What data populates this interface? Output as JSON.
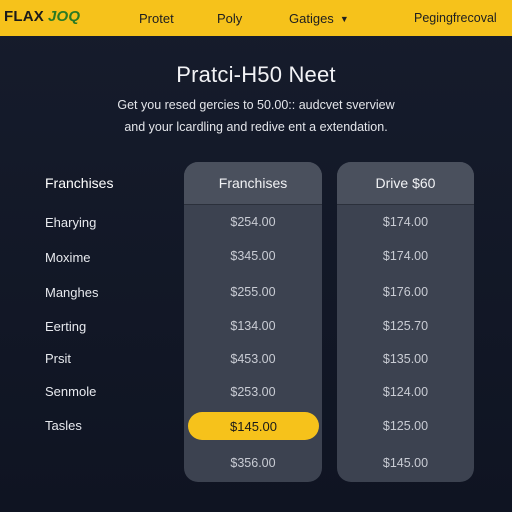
{
  "nav": {
    "logo_part1": "FLAX",
    "logo_part2": "JOQ",
    "product": "Protet",
    "policy": "Poly",
    "categories": "Gatiges",
    "right": "Pegingfrecoval"
  },
  "hero": {
    "title": "Pratci-H50 Neet",
    "subtitle_line1": "Get you resed gercies to 50.00:: audcvet sverview",
    "subtitle_line2": "and your lcardling and redive ent a extendation."
  },
  "table": {
    "row_header": "Franchises",
    "columns": [
      "Franchises",
      "Drive $60"
    ],
    "rows": [
      {
        "label": "Eharying",
        "c1": "$254.00",
        "c2": "$174.00"
      },
      {
        "label": "Moxime",
        "c1": "$345.00",
        "c2": "$174.00"
      },
      {
        "label": "Manghes",
        "c1": "$255.00",
        "c2": "$176.00"
      },
      {
        "label": "Eerting",
        "c1": "$134.00",
        "c2": "$125.70"
      },
      {
        "label": "Prsit",
        "c1": "$453.00",
        "c2": "$135.00"
      },
      {
        "label": "Senmole",
        "c1": "$253.00",
        "c2": "$124.00"
      },
      {
        "label": "Tasles",
        "c1": "$145.00",
        "c2": "$125.00"
      },
      {
        "label": "",
        "c1": "$356.00",
        "c2": "$145.00"
      }
    ]
  },
  "colors": {
    "accent": "#f6c21b",
    "background": "#121726",
    "card": "#3c4250"
  }
}
